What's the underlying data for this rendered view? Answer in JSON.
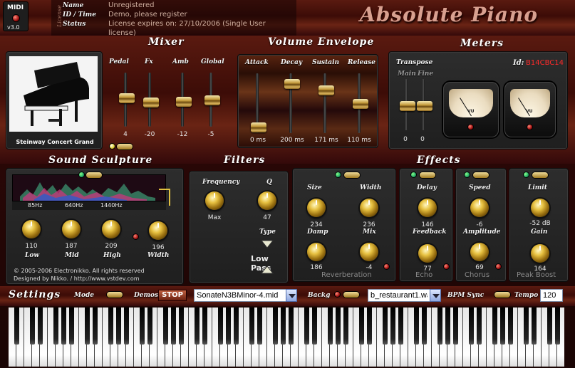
{
  "header": {
    "midi_label": "MIDI",
    "version": "v3.0",
    "license_tag": "License",
    "info_rows": [
      {
        "key": "Name",
        "value": "Unregistered"
      },
      {
        "key": "ID / Time",
        "value": "Demo, please register"
      },
      {
        "key": "Status",
        "value": "License expires on: 27/10/2006 (Single User"
      }
    ],
    "status_overflow": "license)",
    "logo": "Absolute Piano"
  },
  "mixer": {
    "title": "Mixer",
    "channels": [
      {
        "label": "Pedal",
        "value": "4",
        "level": 0.35
      },
      {
        "label": "Fx",
        "value": "-20",
        "level": 0.55
      },
      {
        "label": "Amb",
        "value": "-12",
        "level": 0.55
      },
      {
        "label": "Global",
        "value": "-5",
        "level": 0.6
      }
    ]
  },
  "envelope": {
    "title": "Volume Envelope",
    "stages": [
      {
        "label": "Attack",
        "value": "0 ms",
        "level": 0.0
      },
      {
        "label": "Decay",
        "value": "200 ms",
        "level": 0.85
      },
      {
        "label": "Sustain",
        "value": "171 ms",
        "level": 0.75
      },
      {
        "label": "Release",
        "value": "110 ms",
        "level": 0.45
      }
    ]
  },
  "meters": {
    "title": "Meters",
    "transpose_label": "Transpose",
    "main_label": "Main",
    "fine_label": "Fine",
    "main_value": "0",
    "fine_value": "0",
    "id_label": "Id:",
    "id_value": "B14CBC14",
    "vu_label": "VU"
  },
  "piano": {
    "name": "Steinway Concert Grand"
  },
  "sculpture": {
    "title": "Sound Sculpture",
    "bands": [
      "85Hz",
      "640Hz",
      "1440Hz"
    ],
    "knobs": [
      {
        "label": "Low",
        "value": "110"
      },
      {
        "label": "Mid",
        "value": "187"
      },
      {
        "label": "High",
        "value": "209"
      },
      {
        "label": "Width",
        "value": "196"
      }
    ]
  },
  "filters": {
    "title": "Filters",
    "frequency_label": "Frequency",
    "frequency_value": "Max",
    "q_label": "Q",
    "q_value": "47",
    "type_label": "Type",
    "type_value": "Low Pass"
  },
  "effects": {
    "title": "Effects",
    "reverb": {
      "name": "Reverberation",
      "size_label": "Size",
      "size_value": "234",
      "width_label": "Width",
      "width_value": "236",
      "damp_label": "Damp",
      "damp_value": "186",
      "mix_label": "Mix",
      "mix_value": "-4"
    },
    "echo": {
      "name": "Echo",
      "delay_label": "Delay",
      "delay_value": "146",
      "feedback_label": "Feedback",
      "feedback_value": "77"
    },
    "chorus": {
      "name": "Chorus",
      "speed_label": "Speed",
      "speed_value": "-6",
      "amplitude_label": "Amplitude",
      "amplitude_value": "69"
    },
    "boost": {
      "name": "Peak Boost",
      "limit_label": "Limit",
      "limit_value": "-52 dB",
      "gain_label": "Gain",
      "gain_value": "164"
    }
  },
  "credits": {
    "copyright": "© 2005-2006 Electronikko. All rights reserved",
    "designed": "Designed by Nikko. / http://www.vstdev.com"
  },
  "settings": {
    "title": "Settings",
    "mode_label": "Mode",
    "demos_label": "Demos",
    "stop_label": "STOP",
    "demo_file": "SonateN3BMinor-4.mid",
    "backg_label": "Backg",
    "backg_file": "b_restaurant1.wav",
    "bpm_label": "BPM Sync",
    "tempo_label": "Tempo",
    "tempo_value": "120"
  }
}
